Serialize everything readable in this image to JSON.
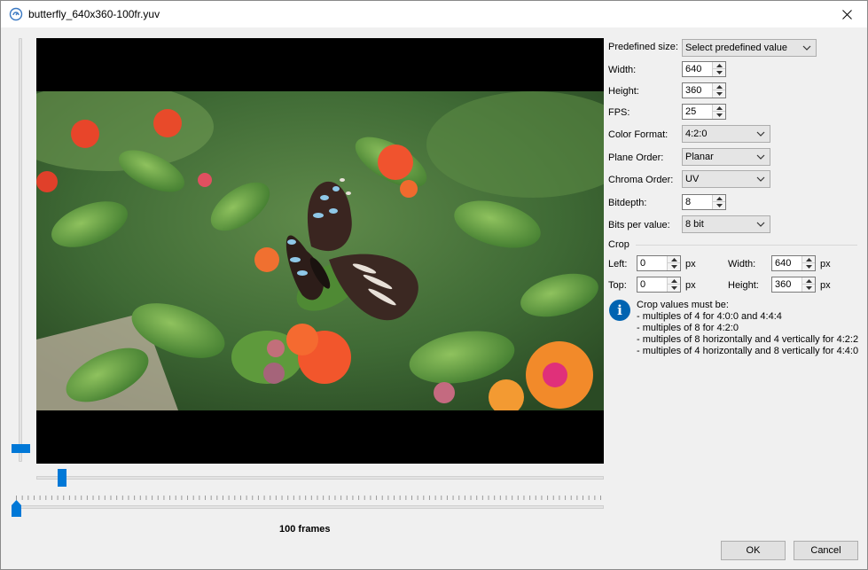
{
  "window": {
    "title": "butterfly_640x360-100fr.yuv",
    "icon": "app-player-icon",
    "close_icon": "close-icon"
  },
  "playback": {
    "frames_label": "100 frames",
    "frame_position": 0.0,
    "zoom_level": 0.08
  },
  "form": {
    "predefined_size": {
      "label": "Predefined size:",
      "value": "Select predefined value"
    },
    "width": {
      "label": "Width:",
      "value": "640"
    },
    "height": {
      "label": "Height:",
      "value": "360"
    },
    "fps": {
      "label": "FPS:",
      "value": "25"
    },
    "color_format": {
      "label": "Color Format:",
      "value": "4:2:0"
    },
    "plane_order": {
      "label": "Plane Order:",
      "value": "Planar"
    },
    "chroma_order": {
      "label": "Chroma Order:",
      "value": "UV"
    },
    "bitdepth": {
      "label": "Bitdepth:",
      "value": "8"
    },
    "bits_per_value": {
      "label": "Bits per value:",
      "value": "8 bit"
    }
  },
  "crop": {
    "group_label": "Crop",
    "left": {
      "label": "Left:",
      "value": "0",
      "unit": "px"
    },
    "top": {
      "label": "Top:",
      "value": "0",
      "unit": "px"
    },
    "width": {
      "label": "Width:",
      "value": "640",
      "unit": "px"
    },
    "height": {
      "label": "Height:",
      "value": "360",
      "unit": "px"
    },
    "info_icon": "info-icon",
    "info_lines": [
      "Crop values must be:",
      "- multiples of 4 for 4:0:0 and 4:4:4",
      "- multiples of 8 for 4:2:0",
      "- multiples of 8 horizontally and 4 vertically for 4:2:2",
      "- multiples of 4 horizontally and 8 vertically for 4:4:0"
    ]
  },
  "buttons": {
    "ok": "OK",
    "cancel": "Cancel"
  },
  "colors": {
    "accent": "#0078d7",
    "info": "#0063b1"
  }
}
